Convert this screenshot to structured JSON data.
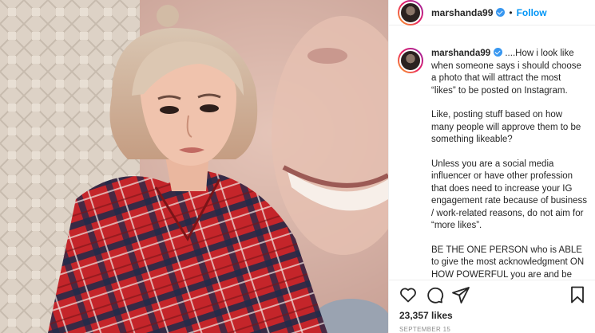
{
  "post": {
    "username": "marshanda99",
    "follow_label": "Follow",
    "separator": "•",
    "caption": {
      "username": "marshanda99",
      "paragraphs": [
        "....How i look like when someone says i should choose a photo that will attract the most “likes” to be posted on Instagram.",
        "Like, posting stuff based on how many people will approve them to be something likeable?",
        "Unless you are a social media influencer or have other profession that does need to increase your IG engagement rate because of business / work-related reasons, do not aim for “more likes”.",
        "BE THE ONE PERSON who is ABLE to give the most acknowledgment ON HOW POWERFUL you are and be the number one FAN and SUPPORTER"
      ]
    },
    "likes": "23,357 likes",
    "date": "SEPTEMBER 15"
  },
  "icons": {
    "like": "heart-icon",
    "comment": "comment-icon",
    "share": "paper-plane-icon",
    "save": "bookmark-icon",
    "verified": "verified-badge-icon"
  },
  "colors": {
    "follow": "#0095f6",
    "verified": "#3897f0",
    "shirt_red": "#c4252a",
    "shirt_navy": "#1f2a4a"
  }
}
